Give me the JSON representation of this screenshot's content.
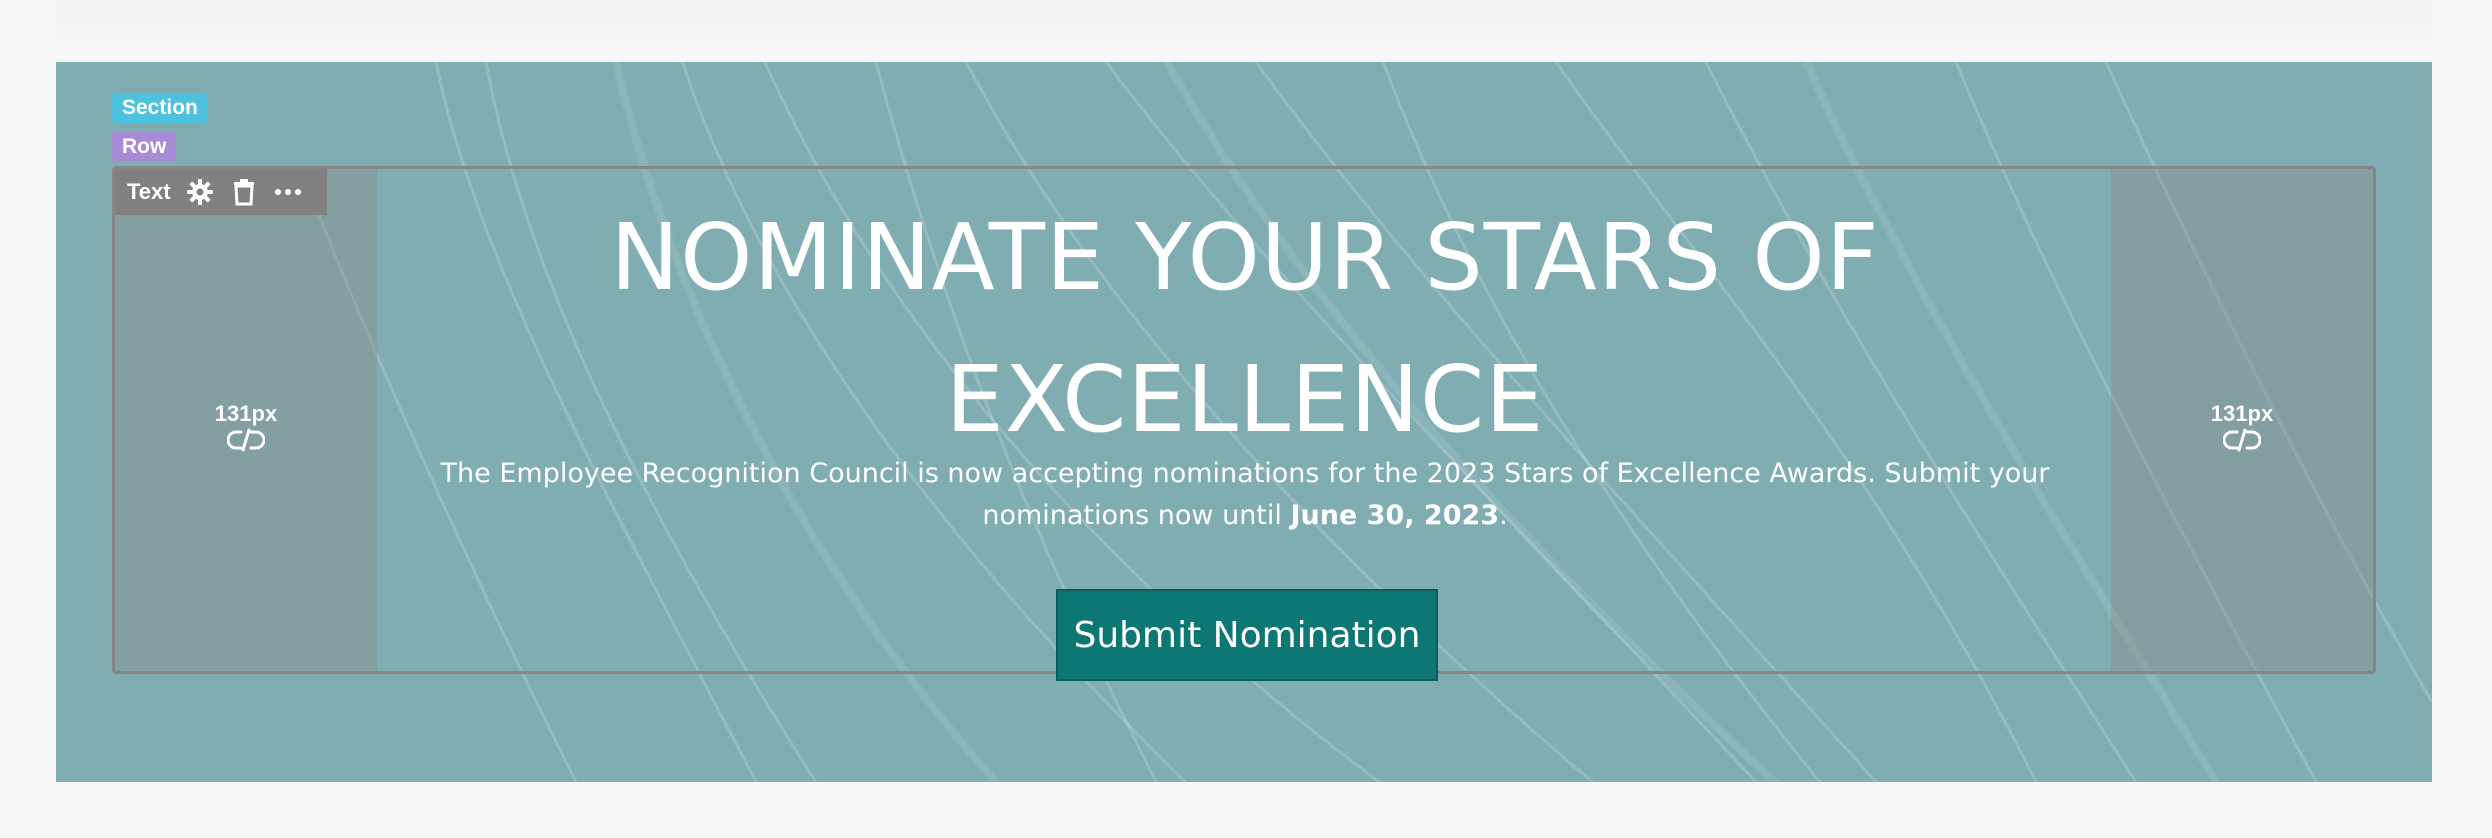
{
  "editor": {
    "section_tag": "Section",
    "row_tag": "Row",
    "toolbar_label": "Text",
    "pad_left_label": "131px",
    "pad_right_label": "131px"
  },
  "hero": {
    "headline_line1": "NOMINATE YOUR STARS OF",
    "headline_line2": "EXCELLENCE",
    "body_prefix": "The Employee Recognition Council is now accepting nominations for the 2023 Stars of Excellence Awards. Submit your nominations now until ",
    "body_date": "June 30, 2023",
    "body_suffix": ".",
    "button_label": "Submit Nomination"
  },
  "colors": {
    "section_bg": "#7fadb1",
    "button_bg": "#0c7773",
    "section_tag": "#4cc3dc",
    "row_tag": "#a78bd6"
  },
  "icons": [
    "gear-icon",
    "trash-icon",
    "more-icon",
    "unlink-icon"
  ]
}
